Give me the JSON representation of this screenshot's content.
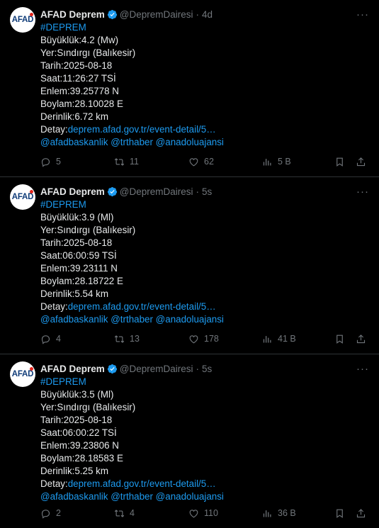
{
  "colors": {
    "background": "#000000",
    "text": "#e7e9ea",
    "muted": "#71767b",
    "link": "#1d9bf0",
    "divider": "#2f3336"
  },
  "tweets": [
    {
      "author": "AFAD Deprem",
      "handle": "@DepremDairesi",
      "time": "4d",
      "avatar_text": "AFAD",
      "hashtag": "#DEPREM",
      "lines": [
        "Büyüklük:4.2 (Mw)",
        "Yer:Sındırgı (Balıkesir)",
        "Tarih:2025-08-18",
        "Saat:11:26:27 TSİ",
        "Enlem:39.25778 N",
        "Boylam:28.10028 E",
        "Derinlik:6.72 km"
      ],
      "detail_label": "Detay:",
      "detail_link": "deprem.afad.gov.tr/event-detail/5…",
      "mentions": "@afadbaskanlik @trthaber @anadoluajansi",
      "replies": "5",
      "retweets": "11",
      "likes": "62",
      "views": "5 B"
    },
    {
      "author": "AFAD Deprem",
      "handle": "@DepremDairesi",
      "time": "5s",
      "avatar_text": "AFAD",
      "hashtag": "#DEPREM",
      "lines": [
        "Büyüklük:3.9 (Ml)",
        "Yer:Sındırgı (Balıkesir)",
        "Tarih:2025-08-18",
        "Saat:06:00:59 TSİ",
        "Enlem:39.23111 N",
        "Boylam:28.18722 E",
        "Derinlik:5.54 km"
      ],
      "detail_label": "Detay:",
      "detail_link": "deprem.afad.gov.tr/event-detail/5…",
      "mentions": "@afadbaskanlik @trthaber @anadoluajansi",
      "replies": "4",
      "retweets": "13",
      "likes": "178",
      "views": "41 B"
    },
    {
      "author": "AFAD Deprem",
      "handle": "@DepremDairesi",
      "time": "5s",
      "avatar_text": "AFAD",
      "hashtag": "#DEPREM",
      "lines": [
        "Büyüklük:3.5 (Ml)",
        "Yer:Sındırgı (Balıkesir)",
        "Tarih:2025-08-18",
        "Saat:06:00:22 TSİ",
        "Enlem:39.23806 N",
        "Boylam:28.18583 E",
        "Derinlik:5.25 km"
      ],
      "detail_label": "Detay:",
      "detail_link": "deprem.afad.gov.tr/event-detail/5…",
      "mentions": "@afadbaskanlik @trthaber @anadoluajansi",
      "replies": "2",
      "retweets": "4",
      "likes": "110",
      "views": "36 B"
    }
  ],
  "icons": {
    "verified": "verified-badge-icon",
    "more": "more-icon",
    "reply": "reply-icon",
    "retweet": "retweet-icon",
    "like": "heart-icon",
    "views": "views-icon",
    "bookmark": "bookmark-icon",
    "share": "share-icon"
  }
}
